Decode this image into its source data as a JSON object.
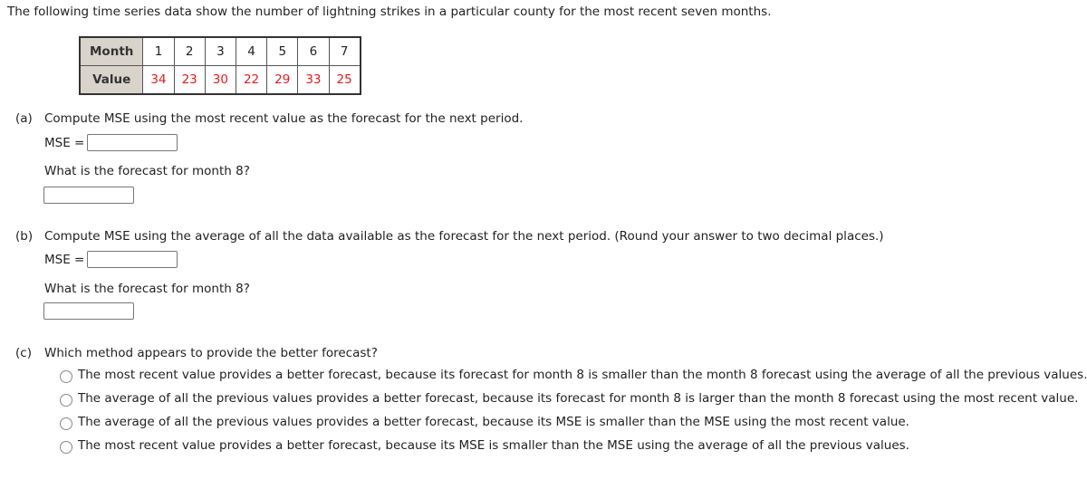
{
  "intro": "The following time series data show the number of lightning strikes in a particular county for the most recent seven months.",
  "table": {
    "row_headers": [
      "Month",
      "Value"
    ],
    "months": [
      "1",
      "2",
      "3",
      "4",
      "5",
      "6",
      "7"
    ],
    "values": [
      "34",
      "23",
      "30",
      "22",
      "29",
      "33",
      "25"
    ]
  },
  "part_a": {
    "tag": "(a)",
    "question": "Compute MSE using the most recent value as the forecast for the next period.",
    "mse_label": "MSE =",
    "mse_value": "",
    "forecast_question": "What is the forecast for month 8?",
    "forecast_value": ""
  },
  "part_b": {
    "tag": "(b)",
    "question": "Compute MSE using the average of all the data available as the forecast for the next period. (Round your answer to two decimal places.)",
    "mse_label": "MSE =",
    "mse_value": "",
    "forecast_question": "What is the forecast for month 8?",
    "forecast_value": ""
  },
  "part_c": {
    "tag": "(c)",
    "question": "Which method appears to provide the better forecast?",
    "options": [
      "The most recent value provides a better forecast, because its forecast for month 8 is smaller than the month 8 forecast using the average of all the previous values.",
      "The average of all the previous values provides a better forecast, because its forecast for month 8 is larger than the month 8 forecast using the most recent value.",
      "The average of all the previous values provides a better forecast, because its MSE is smaller than the MSE using the most recent value.",
      "The most recent value provides a better forecast, because its MSE is smaller than the MSE using the average of all the previous values."
    ]
  }
}
